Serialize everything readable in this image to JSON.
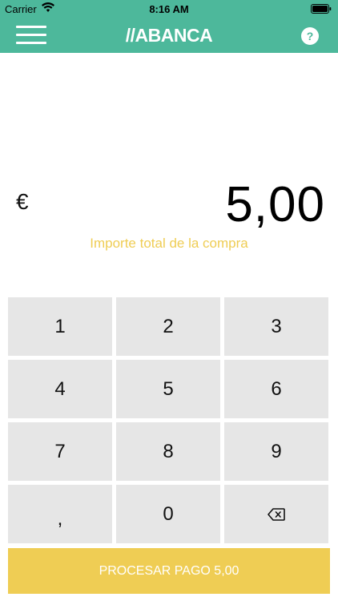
{
  "status_bar": {
    "carrier": "Carrier",
    "time": "8:16 AM",
    "wifi_icon": "wifi-icon",
    "battery_icon": "battery-icon"
  },
  "nav": {
    "menu_icon": "hamburger-menu-icon",
    "logo": "//ABANCA",
    "help_label": "?",
    "bar_color": "#4db89b"
  },
  "amount": {
    "currency": "€",
    "value": "5,00",
    "caption": "Importe total de la compra",
    "caption_color": "#efcd54"
  },
  "keypad": {
    "keys": [
      "1",
      "2",
      "3",
      "4",
      "5",
      "6",
      "7",
      "8",
      "9",
      ",",
      "0"
    ],
    "backspace_icon": "backspace-icon",
    "key_color": "#e6e6e6"
  },
  "process_button": {
    "label": "PROCESAR PAGO 5,00",
    "color": "#efcd54"
  }
}
